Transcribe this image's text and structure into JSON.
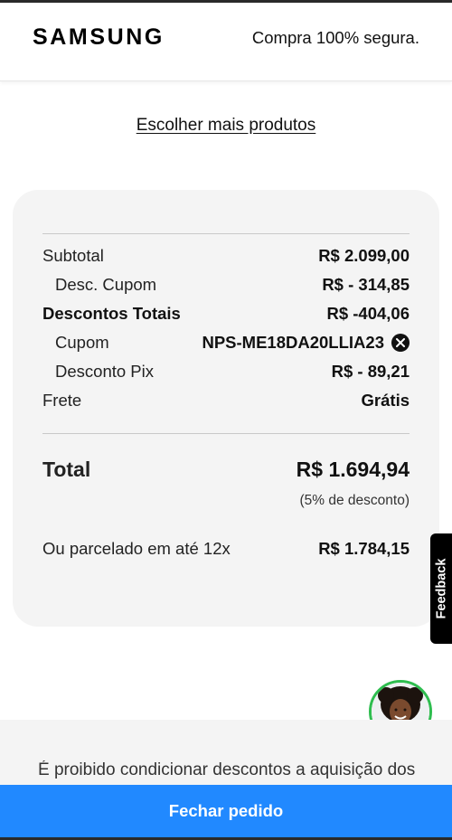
{
  "header": {
    "logo_text": "SAMSUNG",
    "secure_text": "Compra 100% segura."
  },
  "links": {
    "more_products": "Escolher mais produtos"
  },
  "summary": {
    "subtotal_label": "Subtotal",
    "subtotal_value": "R$ 2.099,00",
    "coupon_discount_label": "Desc. Cupom",
    "coupon_discount_value": "R$ - 314,85",
    "total_discounts_label": "Descontos Totais",
    "total_discounts_value": "R$ -404,06",
    "coupon_label": "Cupom",
    "coupon_code": "NPS-ME18DA20LLIA23",
    "pix_discount_label": "Desconto Pix",
    "pix_discount_value": "R$ - 89,21",
    "shipping_label": "Frete",
    "shipping_value": "Grátis",
    "total_label": "Total",
    "total_value": "R$ 1.694,94",
    "discount_note": "(5% de desconto)",
    "installments_label": "Ou parcelado em até 12x",
    "installments_value": "R$ 1.784,15"
  },
  "feedback": {
    "label": "Feedback"
  },
  "legal": {
    "text": "É proibido condicionar descontos a aquisição dos"
  },
  "cta": {
    "label": "Fechar pedido"
  },
  "colors": {
    "cta_blue": "#2189ff",
    "avatar_ring": "#2ebd4f",
    "card_bg": "#f4f4f4"
  },
  "icons": {
    "remove_coupon": "close-icon",
    "chat_agent": "avatar"
  }
}
